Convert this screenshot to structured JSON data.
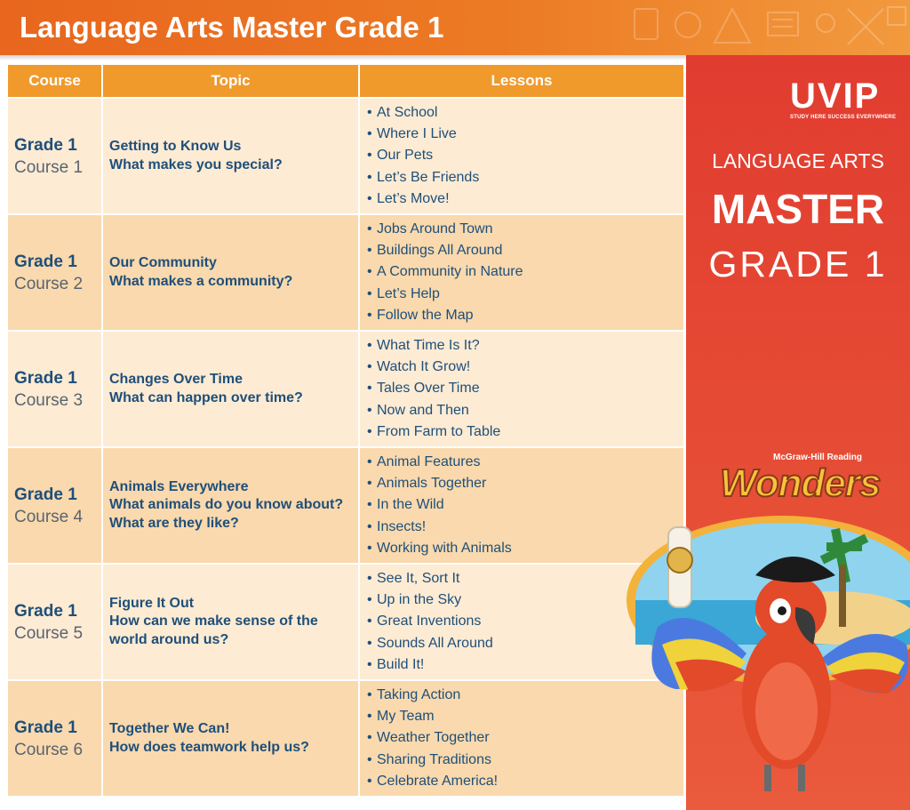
{
  "header": {
    "title": "Language Arts Master Grade 1"
  },
  "table": {
    "headers": {
      "course": "Course",
      "topic": "Topic",
      "lessons": "Lessons"
    },
    "rows": [
      {
        "grade": "Grade 1",
        "course": "Course 1",
        "topic": [
          "Getting to Know Us",
          "What makes you special?"
        ],
        "lessons": [
          "At School",
          "Where I Live",
          "Our Pets",
          "Let’s Be Friends",
          "Let’s Move!"
        ]
      },
      {
        "grade": "Grade 1",
        "course": "Course 2",
        "topic": [
          "Our Community",
          "What makes a community?"
        ],
        "lessons": [
          "Jobs Around Town",
          "Buildings All Around",
          "A Community in Nature",
          "Let’s Help",
          "Follow the Map"
        ]
      },
      {
        "grade": "Grade 1",
        "course": "Course 3",
        "topic": [
          "Changes Over Time",
          "What can happen over time?"
        ],
        "lessons": [
          "What Time Is It?",
          "Watch It Grow!",
          "Tales Over Time",
          "Now and Then",
          "From Farm to Table"
        ]
      },
      {
        "grade": "Grade 1",
        "course": "Course 4",
        "topic": [
          "Animals Everywhere",
          "What animals do you know about?",
          "What are they like?"
        ],
        "lessons": [
          "Animal Features",
          "Animals Together",
          "In the Wild",
          "Insects!",
          "Working with Animals"
        ]
      },
      {
        "grade": "Grade 1",
        "course": "Course 5",
        "topic": [
          "Figure It Out",
          "How can we make sense of the",
          "world around us?"
        ],
        "lessons": [
          "See It, Sort It",
          "Up in the Sky",
          "Great Inventions",
          "Sounds All Around",
          "Build It!"
        ]
      },
      {
        "grade": "Grade 1",
        "course": "Course 6",
        "topic": [
          "Together We Can!",
          "How does teamwork help us?"
        ],
        "lessons": [
          "Taking Action",
          "My Team",
          "Weather Together",
          "Sharing Traditions",
          "Celebrate America!"
        ]
      }
    ]
  },
  "sidebar": {
    "logo": "UVIP",
    "tagline": "STUDY HERE SUCCESS EVERYWHERE",
    "line1": "LANGUAGE ARTS",
    "line2": "MASTER",
    "line3": "GRADE 1",
    "brand_publisher": "McGraw-Hill Reading",
    "brand_name": "Wonders"
  },
  "colors": {
    "header_orange": "#e8661e",
    "table_header": "#f09a2c",
    "row_light": "#fdebd3",
    "row_dark": "#f9d9ad",
    "text_blue": "#1f4f7a",
    "sidebar_red": "#e13c30"
  }
}
